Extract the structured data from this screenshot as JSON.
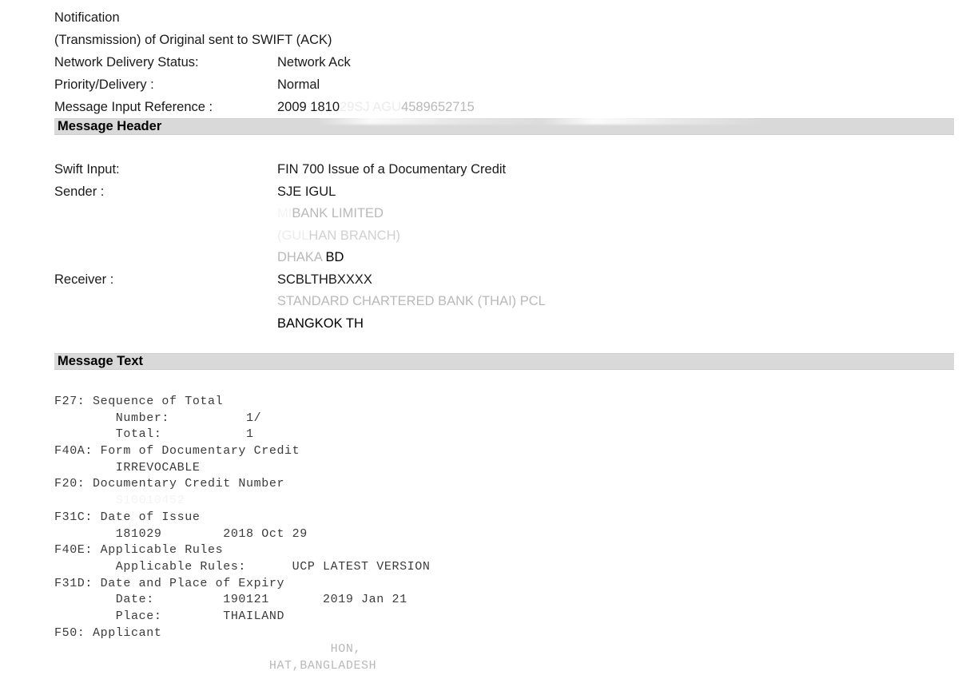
{
  "notification": {
    "title": "Notification",
    "subtitle": "(Transmission) of Original sent to SWIFT (ACK)",
    "rows": [
      {
        "label": "Network Delivery Status:",
        "value": "Network Ack"
      },
      {
        "label": "Priority/Delivery :",
        "value": "Normal"
      }
    ],
    "message_input_reference": {
      "label": "Message Input Reference :",
      "value_visible_prefix": "2009 1810",
      "value_redacted_mid": "29SJ",
      "value_redacted_gap": "       ",
      "value_redacted_tail": "AGU",
      "value_visible_suffix": "4589652715"
    }
  },
  "sections": {
    "message_header_banner": "Message Header",
    "message_text_banner": "Message Text"
  },
  "header": {
    "swift_input": {
      "label": "Swift Input:",
      "value": "FIN 700 Issue of a Documentary Credit"
    },
    "sender": {
      "label": "Sender :",
      "bic_redacted": "SJE       IGUL",
      "name_redacted_prefix": "                  MI",
      "name_visible": "BANK LIMITED",
      "branch_redacted_prefix": "(GUL",
      "branch_visible": "HAN BRANCH)",
      "city": "DHAKA",
      "country": "BD"
    },
    "receiver": {
      "label": "Receiver :",
      "bic": "SCBLTHBXXXX",
      "name": "STANDARD CHARTERED BANK (THAI) PCL",
      "city_country": "BANGKOK TH"
    }
  },
  "message_text": {
    "lines": [
      {
        "text": "F27: Sequence of Total",
        "style": "normal"
      },
      {
        "text": "        Number:          1/",
        "style": "normal"
      },
      {
        "text": "        Total:           1",
        "style": "normal"
      },
      {
        "text": "F40A: Form of Documentary Credit",
        "style": "normal"
      },
      {
        "text": "        IRREVOCABLE",
        "style": "normal"
      },
      {
        "text": "F20: Documentary Credit Number",
        "style": "normal"
      },
      {
        "text": "        S10010452",
        "style": "redacted"
      },
      {
        "text": "F31C: Date of Issue",
        "style": "normal"
      },
      {
        "text": "        181029        2018 Oct 29",
        "style": "normal"
      },
      {
        "text": "F40E: Applicable Rules",
        "style": "normal"
      },
      {
        "text": "        Applicable Rules:      UCP LATEST VERSION",
        "style": "normal"
      },
      {
        "text": "F31D: Date and Place of Expiry",
        "style": "normal"
      },
      {
        "text": "        Date:         190121       2019 Jan 21",
        "style": "normal"
      },
      {
        "text": "        Place:        THAILAND",
        "style": "normal"
      },
      {
        "text": "F50: Applicant",
        "style": "normal"
      },
      {
        "text": "                                    HON,",
        "style": "redacted-partial-a"
      },
      {
        "text": "                            HAT,BANGLADESH",
        "style": "redacted-partial-b"
      }
    ]
  },
  "colors": {
    "banner_background": "#d9d9d9",
    "text_primary": "#1a1a1a",
    "mono_text": "#3b3b3b",
    "page_background": "#ffffff"
  }
}
